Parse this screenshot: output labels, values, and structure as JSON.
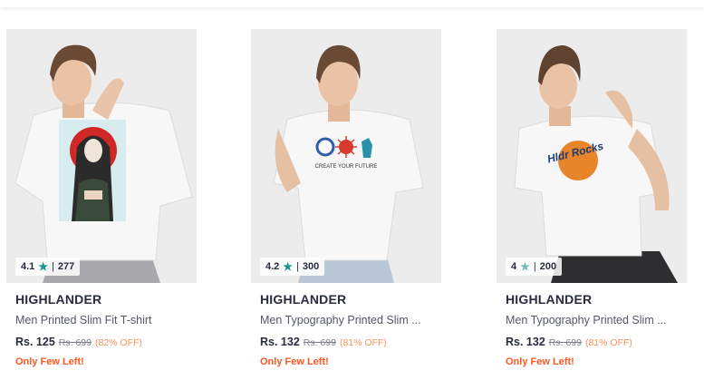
{
  "colors": {
    "rating_star": "#14958f",
    "brand_text": "#282c3f",
    "discount": "#ff905a",
    "few_left": "#ff5722"
  },
  "products": [
    {
      "brand": "HIGHLANDER",
      "title": "Men Printed Slim Fit T-shirt",
      "rating": "4.1",
      "rating_count": "277",
      "price": "Rs. 125",
      "mrp": "Rs. 699",
      "discount": "(82% OFF)",
      "stock_note": "Only Few Left!",
      "image_icon": "model-tshirt-mona-lisa-print-image"
    },
    {
      "brand": "HIGHLANDER",
      "title": "Men Typography Printed Slim ...",
      "rating": "4.2",
      "rating_count": "300",
      "price": "Rs. 132",
      "mrp": "Rs. 699",
      "discount": "(81% OFF)",
      "stock_note": "Only Few Left!",
      "image_icon": "model-tshirt-create-your-future-print-image"
    },
    {
      "brand": "HIGHLANDER",
      "title": "Men Typography Printed Slim ...",
      "rating": "4",
      "rating_count": "200",
      "price": "Rs. 132",
      "mrp": "Rs. 699",
      "discount": "(81% OFF)",
      "stock_note": "Only Few Left!",
      "image_icon": "model-tshirt-hldr-rocks-print-image"
    }
  ],
  "print_texts": {
    "card2": "CREATE YOUR FUTURE",
    "card3": "Hldr Rocks"
  }
}
